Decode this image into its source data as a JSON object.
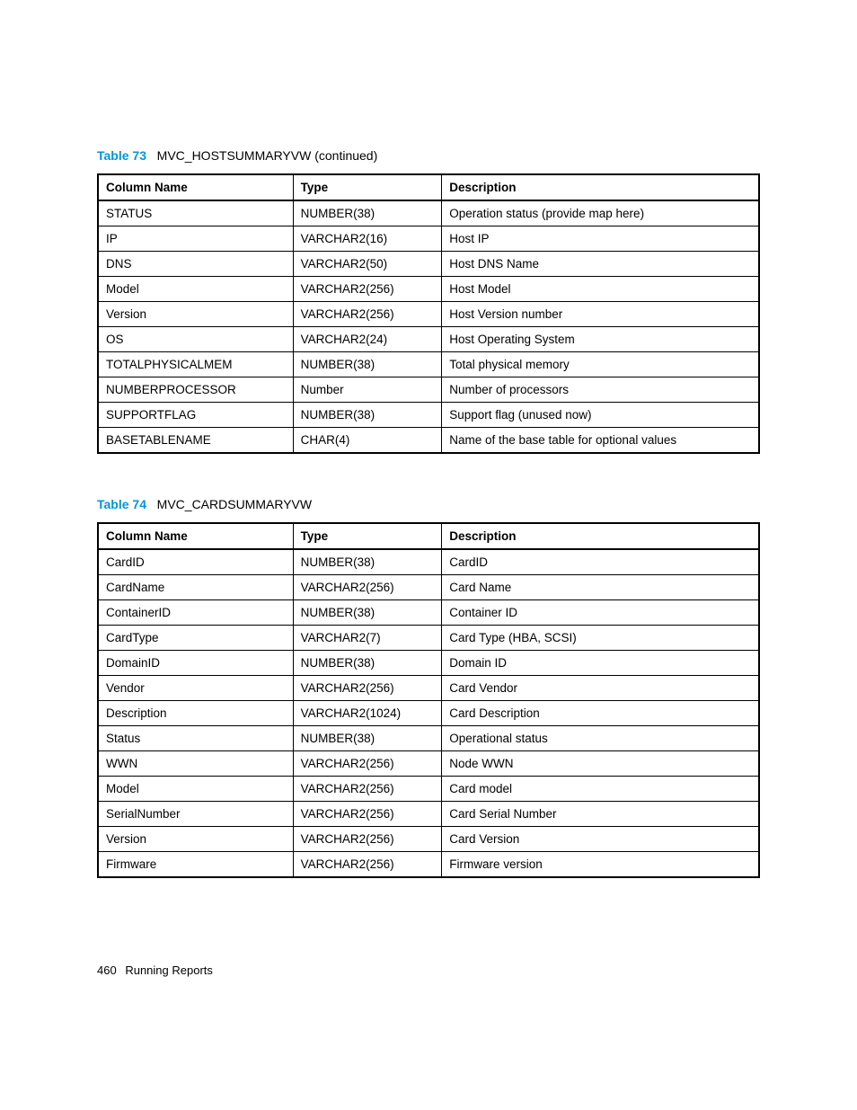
{
  "table73": {
    "caption_label": "Table 73",
    "caption_title": "MVC_HOSTSUMMARYVW (continued)",
    "headers": {
      "col1": "Column Name",
      "col2": "Type",
      "col3": "Description"
    },
    "rows": [
      {
        "name": "STATUS",
        "type": "NUMBER(38)",
        "desc": "Operation status (provide map here)"
      },
      {
        "name": "IP",
        "type": "VARCHAR2(16)",
        "desc": "Host IP"
      },
      {
        "name": "DNS",
        "type": "VARCHAR2(50)",
        "desc": "Host DNS Name"
      },
      {
        "name": "Model",
        "type": "VARCHAR2(256)",
        "desc": "Host Model"
      },
      {
        "name": "Version",
        "type": "VARCHAR2(256)",
        "desc": "Host Version number"
      },
      {
        "name": "OS",
        "type": "VARCHAR2(24)",
        "desc": "Host Operating System"
      },
      {
        "name": "TOTALPHYSICALMEM",
        "type": "NUMBER(38)",
        "desc": "Total physical memory"
      },
      {
        "name": "NUMBERPROCESSOR",
        "type": "Number",
        "desc": "Number of processors"
      },
      {
        "name": "SUPPORTFLAG",
        "type": "NUMBER(38)",
        "desc": "Support flag (unused now)"
      },
      {
        "name": "BASETABLENAME",
        "type": "CHAR(4)",
        "desc": "Name of the base table for optional values"
      }
    ]
  },
  "table74": {
    "caption_label": "Table 74",
    "caption_title": "MVC_CARDSUMMARYVW",
    "headers": {
      "col1": "Column Name",
      "col2": "Type",
      "col3": "Description"
    },
    "rows": [
      {
        "name": "CardID",
        "type": "NUMBER(38)",
        "desc": "CardID"
      },
      {
        "name": "CardName",
        "type": "VARCHAR2(256)",
        "desc": "Card Name"
      },
      {
        "name": "ContainerID",
        "type": "NUMBER(38)",
        "desc": "Container ID"
      },
      {
        "name": "CardType",
        "type": "VARCHAR2(7)",
        "desc": "Card Type (HBA, SCSI)"
      },
      {
        "name": "DomainID",
        "type": "NUMBER(38)",
        "desc": "Domain ID"
      },
      {
        "name": "Vendor",
        "type": "VARCHAR2(256)",
        "desc": "Card Vendor"
      },
      {
        "name": "Description",
        "type": "VARCHAR2(1024)",
        "desc": "Card Description"
      },
      {
        "name": "Status",
        "type": "NUMBER(38)",
        "desc": "Operational status"
      },
      {
        "name": "WWN",
        "type": "VARCHAR2(256)",
        "desc": "Node WWN"
      },
      {
        "name": "Model",
        "type": "VARCHAR2(256)",
        "desc": "Card model"
      },
      {
        "name": "SerialNumber",
        "type": "VARCHAR2(256)",
        "desc": "Card Serial Number"
      },
      {
        "name": "Version",
        "type": "VARCHAR2(256)",
        "desc": "Card Version"
      },
      {
        "name": "Firmware",
        "type": "VARCHAR2(256)",
        "desc": "Firmware version"
      }
    ]
  },
  "footer": {
    "page": "460",
    "section": "Running Reports"
  },
  "chart_data": [
    {
      "type": "table",
      "title": "Table 73 MVC_HOSTSUMMARYVW (continued)",
      "columns": [
        "Column Name",
        "Type",
        "Description"
      ],
      "rows": [
        [
          "STATUS",
          "NUMBER(38)",
          "Operation status (provide map here)"
        ],
        [
          "IP",
          "VARCHAR2(16)",
          "Host IP"
        ],
        [
          "DNS",
          "VARCHAR2(50)",
          "Host DNS Name"
        ],
        [
          "Model",
          "VARCHAR2(256)",
          "Host Model"
        ],
        [
          "Version",
          "VARCHAR2(256)",
          "Host Version number"
        ],
        [
          "OS",
          "VARCHAR2(24)",
          "Host Operating System"
        ],
        [
          "TOTALPHYSICALMEM",
          "NUMBER(38)",
          "Total physical memory"
        ],
        [
          "NUMBERPROCESSOR",
          "Number",
          "Number of processors"
        ],
        [
          "SUPPORTFLAG",
          "NUMBER(38)",
          "Support flag (unused now)"
        ],
        [
          "BASETABLENAME",
          "CHAR(4)",
          "Name of the base table for optional values"
        ]
      ]
    },
    {
      "type": "table",
      "title": "Table 74 MVC_CARDSUMMARYVW",
      "columns": [
        "Column Name",
        "Type",
        "Description"
      ],
      "rows": [
        [
          "CardID",
          "NUMBER(38)",
          "CardID"
        ],
        [
          "CardName",
          "VARCHAR2(256)",
          "Card Name"
        ],
        [
          "ContainerID",
          "NUMBER(38)",
          "Container ID"
        ],
        [
          "CardType",
          "VARCHAR2(7)",
          "Card Type (HBA, SCSI)"
        ],
        [
          "DomainID",
          "NUMBER(38)",
          "Domain ID"
        ],
        [
          "Vendor",
          "VARCHAR2(256)",
          "Card Vendor"
        ],
        [
          "Description",
          "VARCHAR2(1024)",
          "Card Description"
        ],
        [
          "Status",
          "NUMBER(38)",
          "Operational status"
        ],
        [
          "WWN",
          "VARCHAR2(256)",
          "Node WWN"
        ],
        [
          "Model",
          "VARCHAR2(256)",
          "Card model"
        ],
        [
          "SerialNumber",
          "VARCHAR2(256)",
          "Card Serial Number"
        ],
        [
          "Version",
          "VARCHAR2(256)",
          "Card Version"
        ],
        [
          "Firmware",
          "VARCHAR2(256)",
          "Firmware version"
        ]
      ]
    }
  ]
}
